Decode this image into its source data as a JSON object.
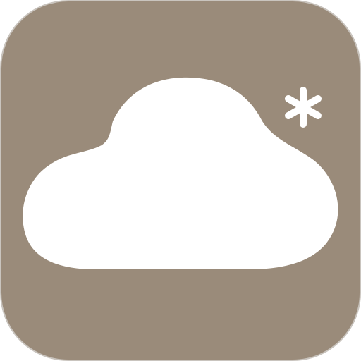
{
  "icon": {
    "semantic": "cloud-snow-weather-icon",
    "colors": {
      "tile": "#9a8b7a",
      "tile_border": "#c9c4be",
      "glyph": "#ffffff"
    }
  }
}
